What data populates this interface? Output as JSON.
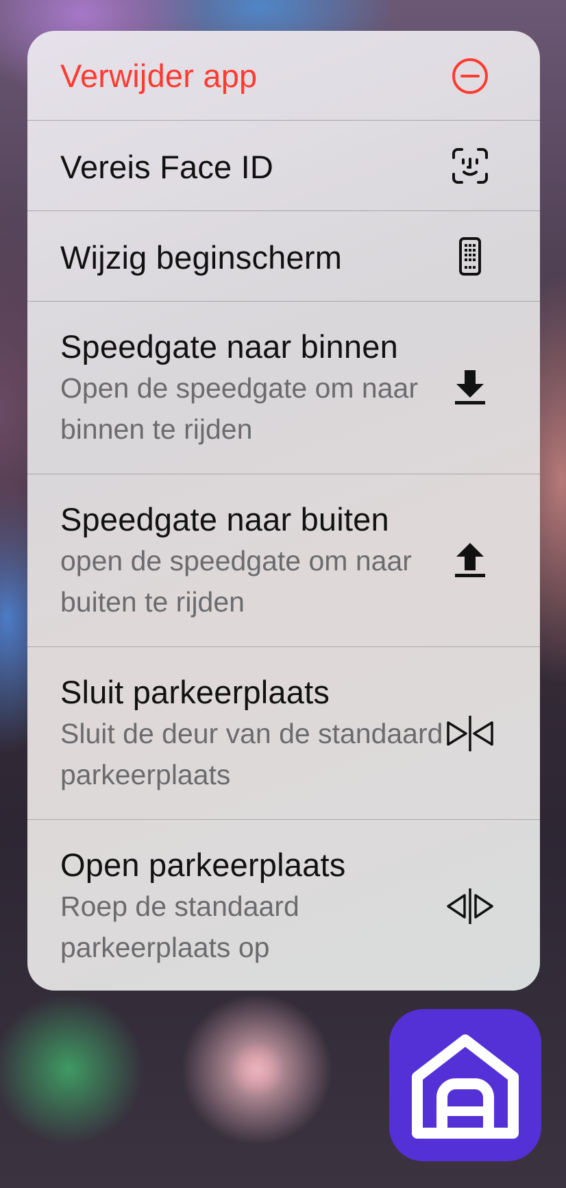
{
  "menu": {
    "items": [
      {
        "title": "Verwijder app",
        "subtitle": "",
        "icon": "minus-circle-icon",
        "destructive": true
      },
      {
        "title": "Vereis Face ID",
        "subtitle": "",
        "icon": "face-id-icon"
      },
      {
        "title": "Wijzig beginscherm",
        "subtitle": "",
        "icon": "phone-apps-icon"
      },
      {
        "title": "Speedgate naar binnen",
        "subtitle": "Open de speedgate om naar binnen te rijden",
        "icon": "download-arrow-icon"
      },
      {
        "title": "Speedgate naar buiten",
        "subtitle": "open de speedgate om naar buiten te rijden",
        "icon": "upload-arrow-icon"
      },
      {
        "title": "Sluit parkeerplaats",
        "subtitle": "Sluit de deur van de standaard parkeerplaats",
        "icon": "close-doors-icon"
      },
      {
        "title": "Open parkeerplaats",
        "subtitle": "Roep de standaard parkeerplaats op",
        "icon": "open-doors-icon"
      }
    ]
  },
  "app_icon": {
    "name": "garage-app-icon",
    "color": "#5431d6"
  },
  "colors": {
    "destructive": "#ff3b30",
    "text": "#111111",
    "subtitle": "#6b6b6e"
  }
}
